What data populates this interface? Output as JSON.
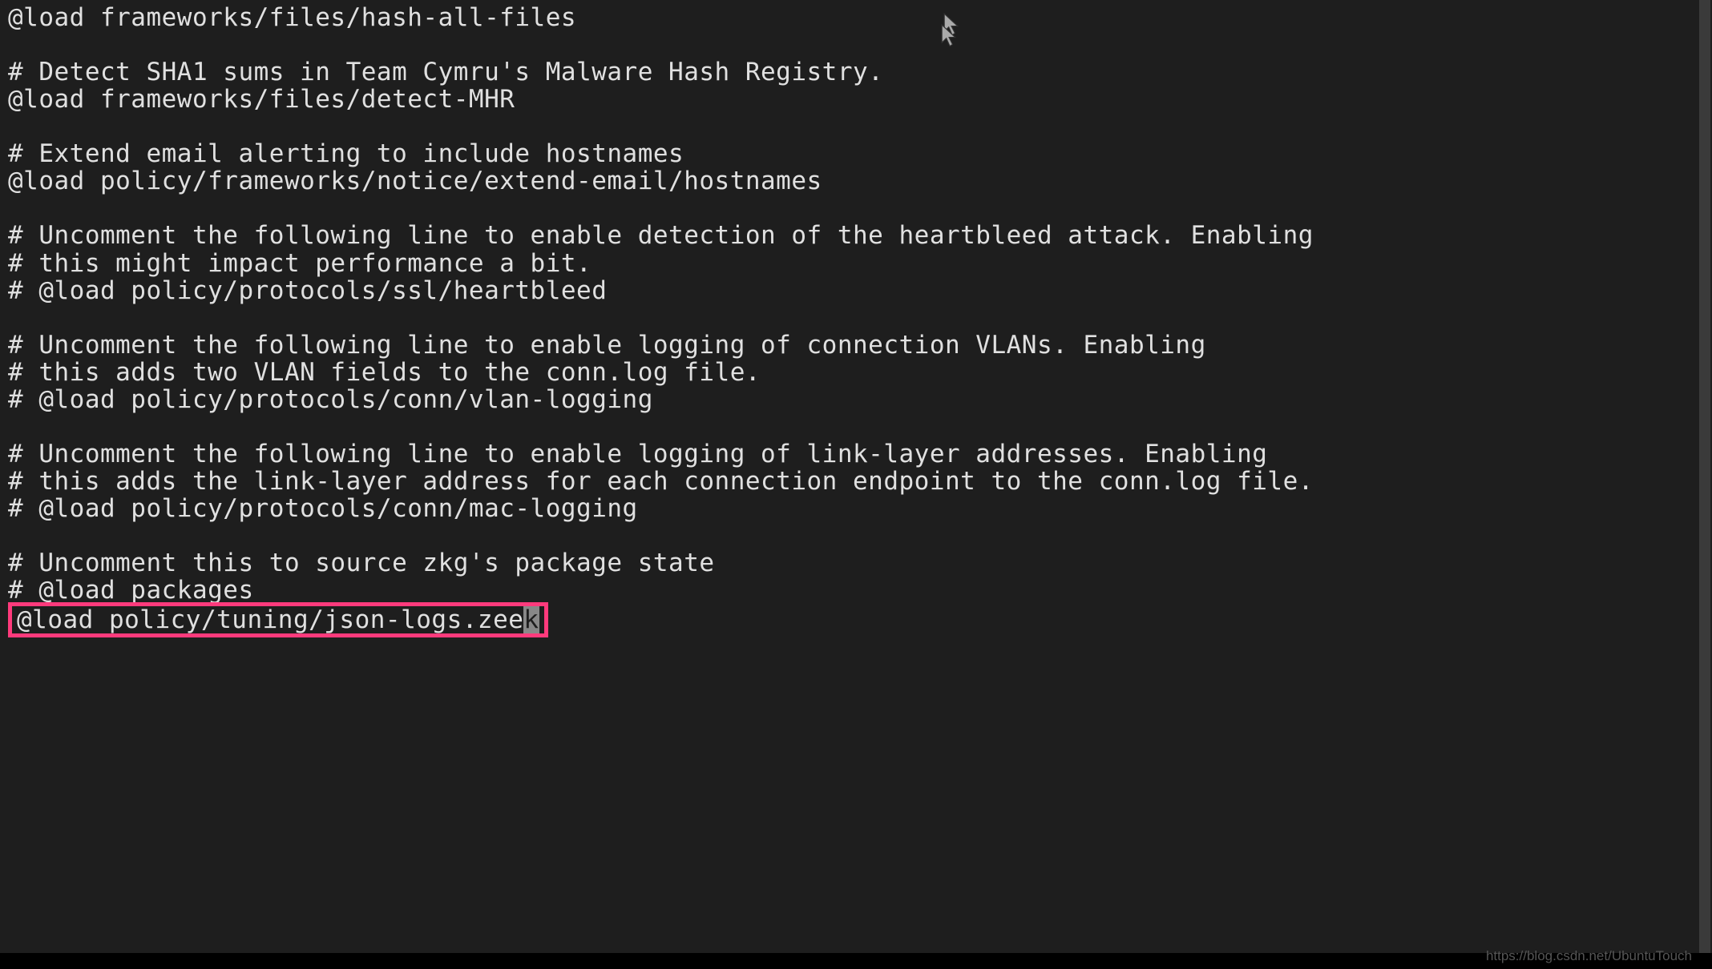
{
  "editor": {
    "lines": [
      "@load frameworks/files/hash-all-files",
      "",
      "# Detect SHA1 sums in Team Cymru's Malware Hash Registry.",
      "@load frameworks/files/detect-MHR",
      "",
      "# Extend email alerting to include hostnames",
      "@load policy/frameworks/notice/extend-email/hostnames",
      "",
      "# Uncomment the following line to enable detection of the heartbleed attack. Enabling",
      "# this might impact performance a bit.",
      "# @load policy/protocols/ssl/heartbleed",
      "",
      "# Uncomment the following line to enable logging of connection VLANs. Enabling",
      "# this adds two VLAN fields to the conn.log file.",
      "# @load policy/protocols/conn/vlan-logging",
      "",
      "# Uncomment the following line to enable logging of link-layer addresses. Enabling",
      "# this adds the link-layer address for each connection endpoint to the conn.log file.",
      "# @load policy/protocols/conn/mac-logging",
      "",
      "# Uncomment this to source zkg's package state",
      "# @load packages"
    ],
    "highlighted_line_prefix": "@load policy/tuning/json-logs.zee",
    "highlighted_line_cursor_char": "k"
  },
  "watermark": "https://blog.csdn.net/UbuntuTouch",
  "colors": {
    "background": "#1e1e1e",
    "text": "#e0e0e0",
    "highlight_border": "#ff3a7c",
    "cursor_block": "#888"
  }
}
